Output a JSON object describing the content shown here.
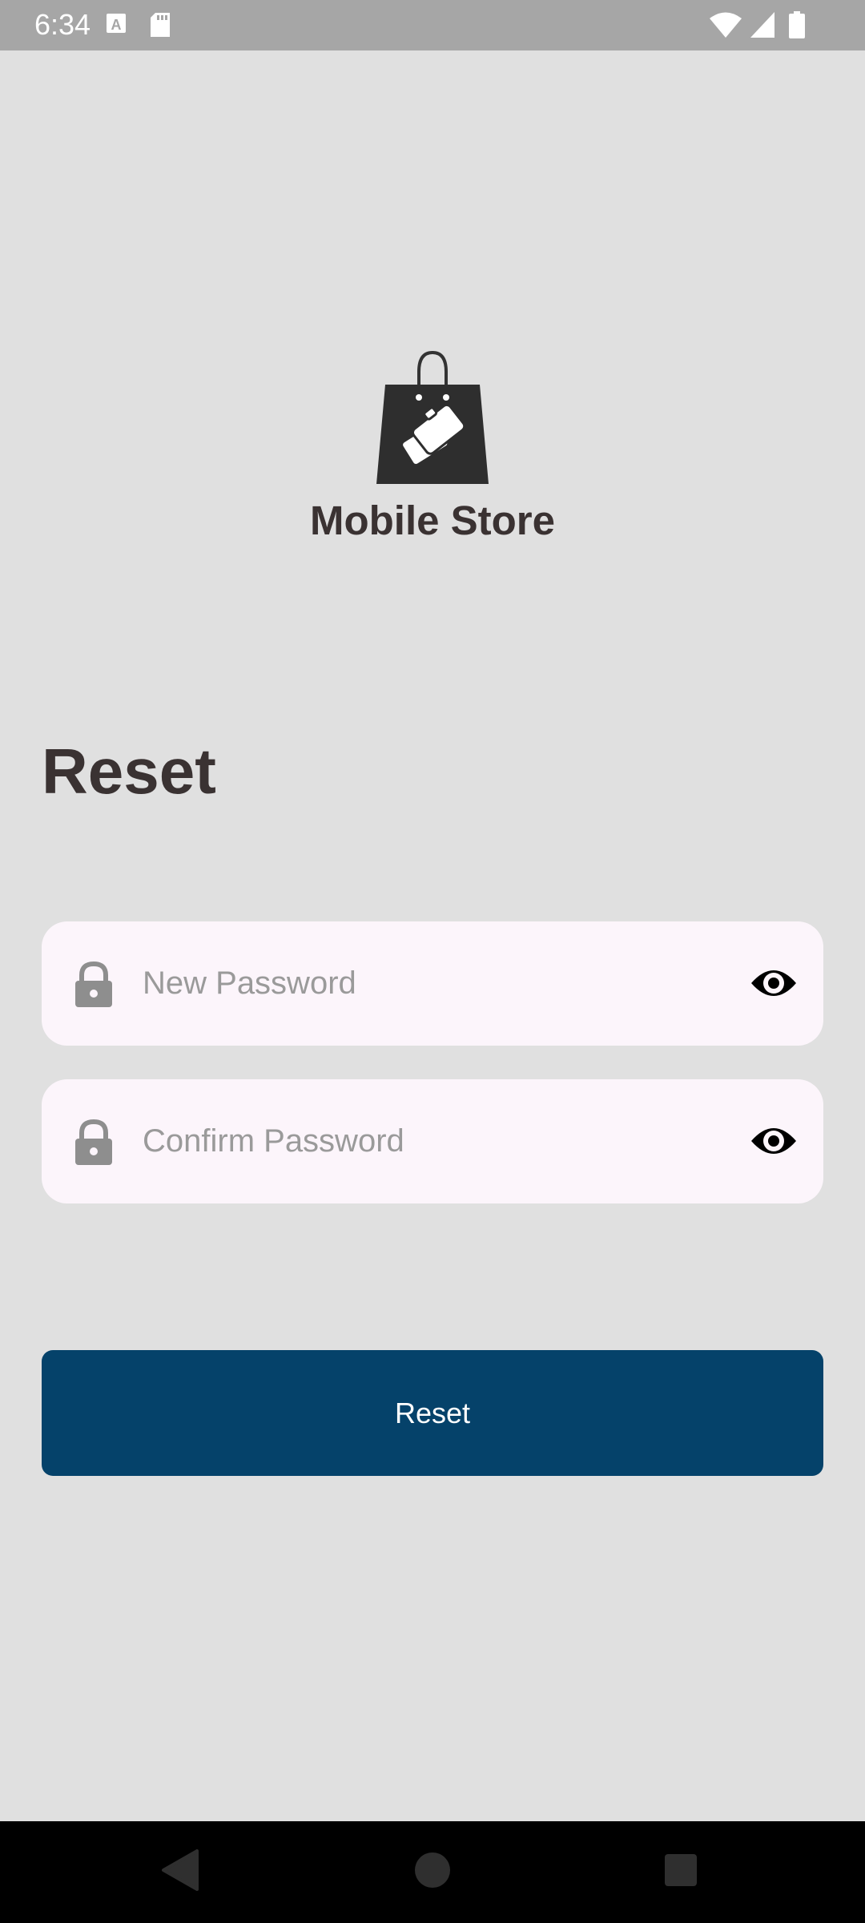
{
  "status_bar": {
    "time": "6:34",
    "icons": [
      "text-a-icon",
      "sd-card-icon",
      "wifi-icon",
      "signal-icon",
      "battery-icon"
    ]
  },
  "brand": {
    "title": "Mobile Store",
    "logo_icon": "shopping-bag-phones-icon"
  },
  "page": {
    "heading": "Reset"
  },
  "form": {
    "new_password": {
      "placeholder": "New Password",
      "value": "",
      "leading_icon": "lock-icon",
      "trailing_icon": "eye-icon"
    },
    "confirm_password": {
      "placeholder": "Confirm Password",
      "value": "",
      "leading_icon": "lock-icon",
      "trailing_icon": "eye-icon"
    },
    "submit_label": "Reset"
  },
  "nav_bar": {
    "buttons": [
      "back-icon",
      "home-icon",
      "recents-icon"
    ]
  },
  "colors": {
    "background": "#e0e0e0",
    "status_bar": "#a6a6a6",
    "field_background": "#fcf5fb",
    "primary_button": "#05426a",
    "heading_text": "#3a3232",
    "placeholder_text": "#9a9a9a"
  }
}
